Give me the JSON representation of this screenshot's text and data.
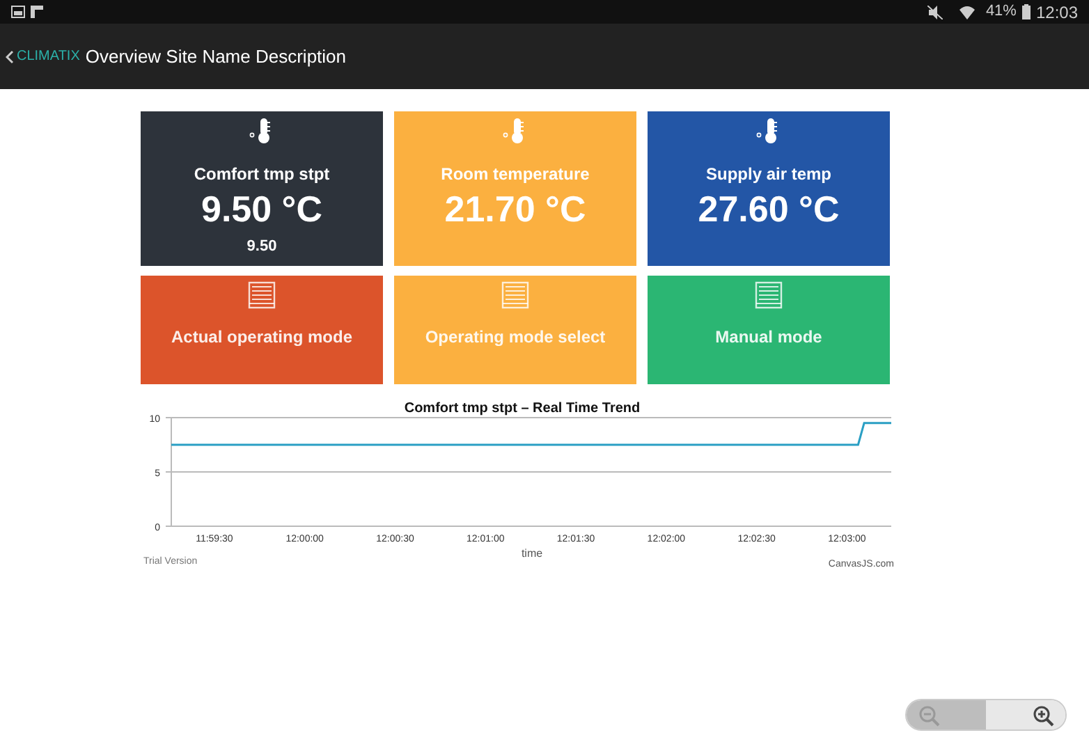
{
  "status_bar": {
    "battery": "41%",
    "time": "12:03"
  },
  "app_bar": {
    "brand": "CLIMATIX",
    "title": "Overview Site Name Description"
  },
  "tiles": [
    {
      "kind": "value",
      "label": "Comfort tmp stpt",
      "value": "9.50 °C",
      "sub": "9.50",
      "color": "#2d333b"
    },
    {
      "kind": "value",
      "label": "Room temperature",
      "value": "21.70 °C",
      "color": "#fbb040"
    },
    {
      "kind": "value",
      "label": "Supply air temp",
      "value": "27.60 °C",
      "color": "#2356a6"
    },
    {
      "kind": "mode",
      "label": "Actual operating mode",
      "color": "#dc542b"
    },
    {
      "kind": "mode",
      "label": "Operating mode select",
      "color": "#fbb040"
    },
    {
      "kind": "mode",
      "label": "Manual mode",
      "color": "#2bb673"
    }
  ],
  "trend": {
    "chart_data": {
      "type": "line",
      "title": "Comfort tmp stpt – Real Time Trend",
      "xlabel": "time",
      "xlim": [
        43155,
        43394
      ],
      "ylim": [
        0,
        10
      ],
      "yticks": [
        0,
        5,
        10
      ],
      "xticks": [
        {
          "value": 43170,
          "label": "11:59:30"
        },
        {
          "value": 43200,
          "label": "12:00:00"
        },
        {
          "value": 43230,
          "label": "12:00:30"
        },
        {
          "value": 43260,
          "label": "12:01:00"
        },
        {
          "value": 43290,
          "label": "12:01:30"
        },
        {
          "value": 43320,
          "label": "12:02:00"
        },
        {
          "value": 43350,
          "label": "12:02:30"
        },
        {
          "value": 43380,
          "label": "12:03:00"
        }
      ],
      "x": [
        43157,
        43383,
        43385,
        43394
      ],
      "series": [
        {
          "color": "#2a9fc4",
          "values": [
            7.5,
            7.5,
            9.5,
            9.5
          ]
        }
      ]
    },
    "watermark_left": "Trial Version",
    "credit": "CanvasJS.com"
  }
}
